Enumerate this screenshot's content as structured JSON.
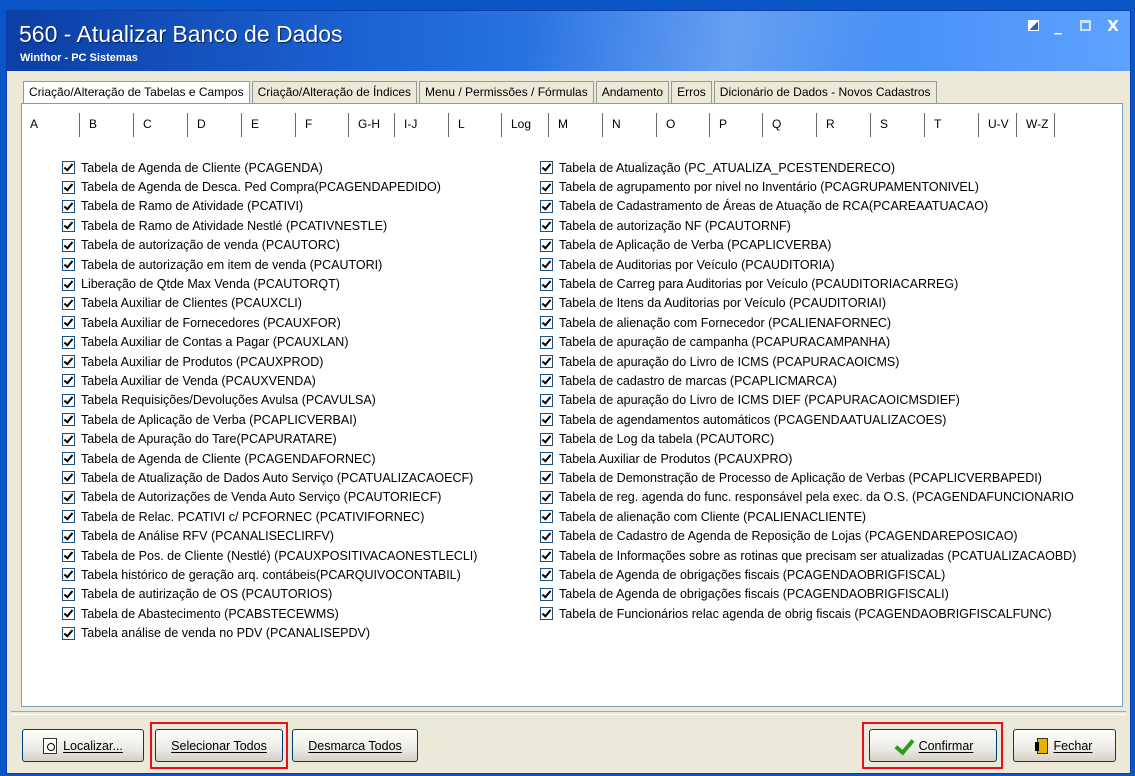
{
  "window": {
    "title": "560 - Atualizar Banco de Dados",
    "subtitle": "Winthor - PC Sistemas",
    "controls": {
      "restore": "",
      "minimize": "_",
      "maximize": "",
      "close": "X"
    }
  },
  "tabs": [
    {
      "label": "Criação/Alteração de Tabelas e Campos",
      "active": true
    },
    {
      "label": "Criação/Alteração de Índices"
    },
    {
      "label": "Menu / Permissões / Fórmulas"
    },
    {
      "label": "Andamento"
    },
    {
      "label": "Erros"
    },
    {
      "label": "Dicionário de Dados - Novos Cadastros"
    }
  ],
  "letter_tabs": [
    "A",
    "B",
    "C",
    "D",
    "E",
    "F",
    "G-H",
    "I-J",
    "L",
    "Log",
    "M",
    "N",
    "O",
    "P",
    "Q",
    "R",
    "S",
    "T",
    "U-V",
    "W-Z"
  ],
  "left_items": [
    "Tabela  de Agenda de Cliente (PCAGENDA)",
    "Tabela  de Agenda de Desca. Ped Compra(PCAGENDAPEDIDO)",
    "Tabela de Ramo de Atividade (PCATIVI)",
    "Tabela de Ramo de Atividade Nestlé (PCATIVNESTLE)",
    "Tabela de autorização de venda (PCAUTORC)",
    "Tabela de autorização em item de venda (PCAUTORI)",
    "Liberação de Qtde Max Venda (PCAUTORQT)",
    "Tabela Auxiliar de Clientes (PCAUXCLI)",
    "Tabela Auxiliar de Fornecedores (PCAUXFOR)",
    "Tabela Auxiliar de Contas a Pagar (PCAUXLAN)",
    "Tabela Auxiliar de Produtos (PCAUXPROD)",
    "Tabela Auxiliar de Venda (PCAUXVENDA)",
    "Tabela Requisições/Devoluções Avulsa (PCAVULSA)",
    "Tabela de Aplicação de Verba (PCAPLICVERBAI)",
    "Tabela de Apuração do Tare(PCAPURATARE)",
    "Tabela  de Agenda de Cliente (PCAGENDAFORNEC)",
    "Tabela  de Atualização de Dados Auto Serviço (PCATUALIZACAOECF)",
    "Tabela de Autorizações de Venda Auto Serviço (PCAUTORIECF)",
    "Tabela de Relac. PCATIVI c/ PCFORNEC (PCATIVIFORNEC)",
    "Tabela de Análise RFV (PCANALISECLIRFV)",
    "Tabela de Pos. de Cliente (Nestlé) (PCAUXPOSITIVACAONESTLECLI)",
    "Tabela histórico de geração arq. contábeis(PCARQUIVOCONTABIL)",
    "Tabela de autirização de OS (PCAUTORIOS)",
    "Tabela de Abastecimento (PCABSTECEWMS)",
    "Tabela análise de venda no PDV (PCANALISEPDV)"
  ],
  "right_items": [
    "Tabela de Atualização (PC_ATUALIZA_PCESTENDERECO)",
    "Tabela de agrupamento por nivel no Inventário (PCAGRUPAMENTONIVEL)",
    "Tabela de Cadastramento de Áreas de Atuação de RCA(PCAREAATUACAO)",
    "Tabela de autorização NF (PCAUTORNF)",
    "Tabela de Aplicação de Verba (PCAPLICVERBA)",
    "Tabela de Auditorias por Veículo (PCAUDITORIA)",
    "Tabela de Carreg para Auditorias por Veículo (PCAUDITORIACARREG)",
    "Tabela de Itens da Auditorias por Veículo (PCAUDITORIAI)",
    "Tabela de alienação com Fornecedor (PCALIENAFORNEC)",
    "Tabela de apuração de campanha (PCAPURACAMPANHA)",
    "Tabela de apuração do Livro de ICMS (PCAPURACAOICMS)",
    "Tabela de cadastro de marcas (PCAPLICMARCA)",
    "Tabela de apuração do Livro de ICMS DIEF (PCAPURACAOICMSDIEF)",
    "Tabela de agendamentos automáticos (PCAGENDAATUALIZACOES)",
    "Tabela de Log da tabela (PCAUTORC)",
    "Tabela Auxiliar de Produtos (PCAUXPRO)",
    "Tabela de Demonstração de Processo de Aplicação de Verbas (PCAPLICVERBAPEDI)",
    "Tabela de reg. agenda do func. responsável pela exec. da O.S. (PCAGENDAFUNCIONARIO",
    "Tabela de alienação com Cliente (PCALIENACLIENTE)",
    "Tabela de Cadastro de Agenda de Reposição de Lojas (PCAGENDAREPOSICAO)",
    "Tabela de Informações sobre as rotinas que precisam ser atualizadas (PCATUALIZACAOBD)",
    "Tabela de Agenda de obrigações fiscais (PCAGENDAOBRIGFISCAL)",
    "Tabela de Agenda de obrigações fiscais (PCAGENDAOBRIGFISCALI)",
    "Tabela de Funcionários relac  agenda de obrig fiscais (PCAGENDAOBRIGFISCALFUNC)"
  ],
  "buttons": {
    "localizar": "Localizar...",
    "selecionar_todos": "Selecionar Todos",
    "desmarca_todos": "Desmarca Todos",
    "confirmar": "Confirmar",
    "fechar": "Fechar"
  },
  "colors": {
    "highlight": "#e8101c",
    "title_bar": "#1e66d8"
  }
}
